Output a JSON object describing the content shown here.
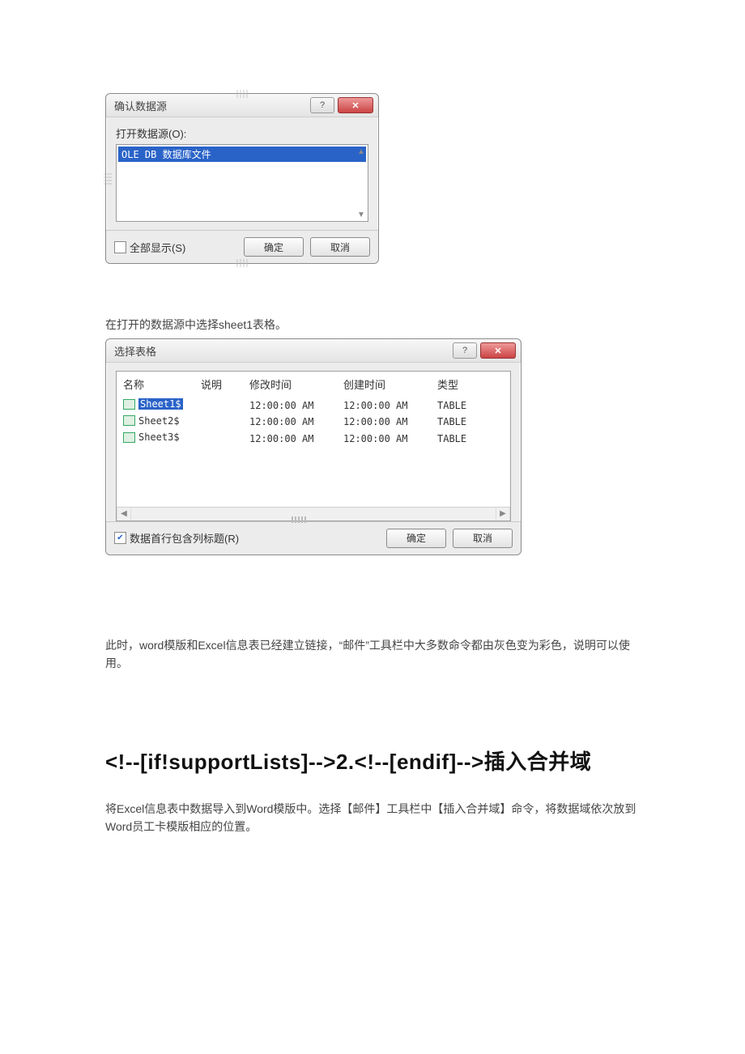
{
  "dialog1": {
    "title": "确认数据源",
    "open_label": "打开数据源(O):",
    "selected_item": "OLE DB 数据库文件",
    "show_all_label": "全部显示(S)",
    "ok": "确定",
    "cancel": "取消"
  },
  "text1": "在打开的数据源中选择sheet1表格。",
  "dialog2": {
    "title": "选择表格",
    "columns": {
      "name": "名称",
      "desc": "说明",
      "modified": "修改时间",
      "created": "创建时间",
      "type": "类型"
    },
    "rows": [
      {
        "name": "Sheet1$",
        "desc": "",
        "modified": "12:00:00 AM",
        "created": "12:00:00 AM",
        "type": "TABLE",
        "selected": true
      },
      {
        "name": "Sheet2$",
        "desc": "",
        "modified": "12:00:00 AM",
        "created": "12:00:00 AM",
        "type": "TABLE",
        "selected": false
      },
      {
        "name": "Sheet3$",
        "desc": "",
        "modified": "12:00:00 AM",
        "created": "12:00:00 AM",
        "type": "TABLE",
        "selected": false
      }
    ],
    "first_row_header_label": "数据首行包含列标题(R)",
    "first_row_header_checked": true,
    "ok": "确定",
    "cancel": "取消"
  },
  "text2": "此时，word模版和Excel信息表已经建立链接，“邮件”工具栏中大多数命令都由灰色变为彩色，说明可以使用。",
  "heading": "<!--[if!supportLists]-->2.<!--[endif]-->插入合并域",
  "text3": "将Excel信息表中数据导入到Word模版中。选择【邮件】工具栏中【插入合并域】命令，将数据域依次放到Word员工卡模版相应的位置。"
}
